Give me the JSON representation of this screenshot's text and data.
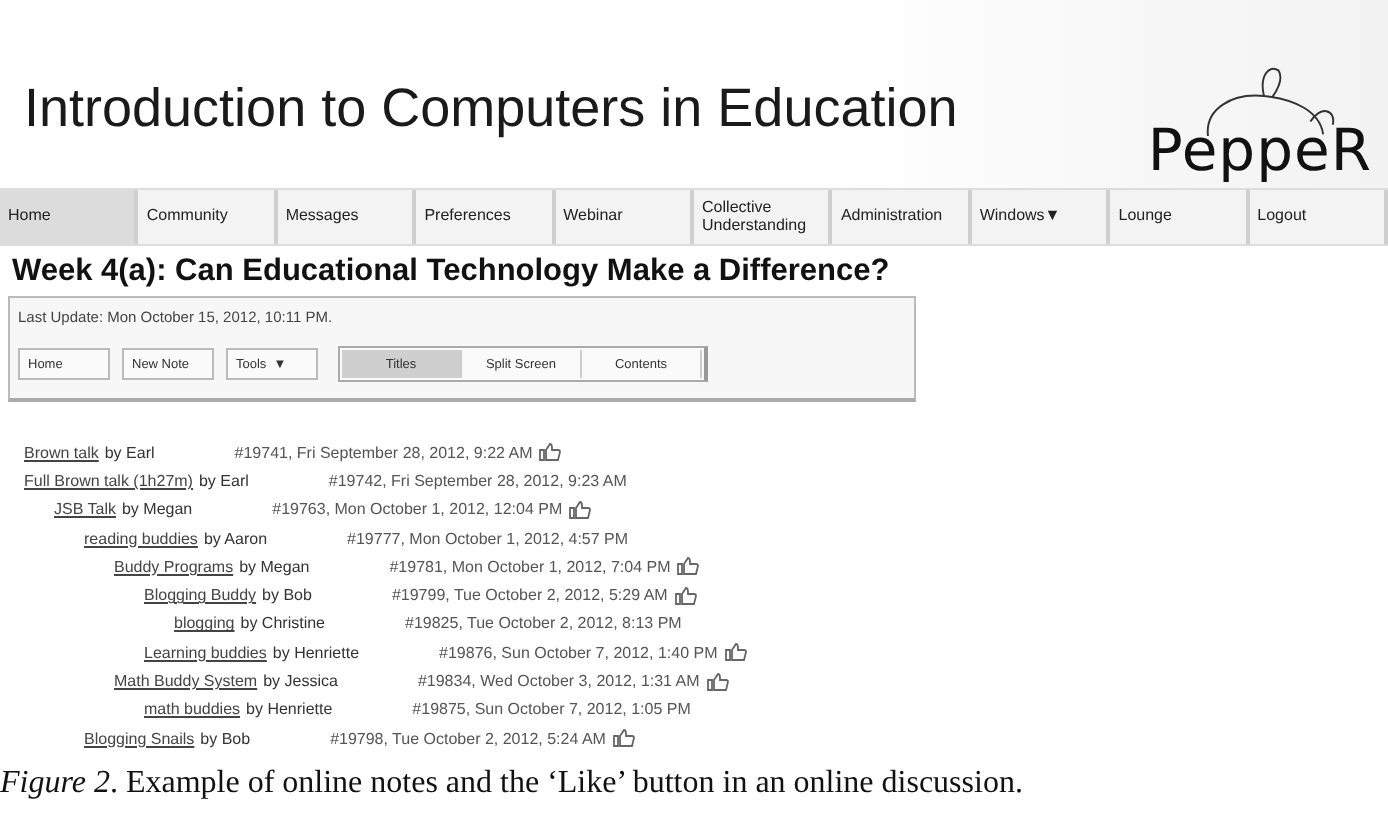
{
  "course_title": "Introduction to Computers in Education",
  "logo": "PeppeR",
  "nav": [
    {
      "label": "Home",
      "selected": true
    },
    {
      "label": "Community",
      "selected": false
    },
    {
      "label": "Messages",
      "selected": false
    },
    {
      "label": "Preferences",
      "selected": false
    },
    {
      "label": "Webinar",
      "selected": false
    },
    {
      "label": "Collective Understanding",
      "selected": false
    },
    {
      "label": "Administration",
      "selected": false
    },
    {
      "label": "Windows",
      "caret": "▼",
      "selected": false
    },
    {
      "label": "Lounge",
      "selected": false
    },
    {
      "label": "Logout",
      "selected": false
    }
  ],
  "view_title": "Week 4(a): Can Educational Technology Make a Difference?",
  "last_update": "Last Update: Mon October 15, 2012, 10:11 PM.",
  "toolbar": [
    {
      "label": "Home"
    },
    {
      "label": "New Note"
    },
    {
      "label": "Tools",
      "caret": "▼"
    }
  ],
  "view_modes": [
    {
      "label": "Titles",
      "selected": true
    },
    {
      "label": "Split Screen",
      "selected": false
    },
    {
      "label": "Contents",
      "selected": false
    }
  ],
  "notes": [
    {
      "title": "Brown talk",
      "by": "by Earl",
      "meta": "#19741, Fri September 28, 2012, 9:22 AM",
      "liked": true
    },
    {
      "title": "Full Brown talk (1h27m)",
      "by": "by Earl",
      "meta": "#19742, Fri September 28, 2012, 9:23 AM",
      "liked": false,
      "children": [
        {
          "title": "JSB Talk",
          "by": "by Megan",
          "meta": "#19763, Mon October 1, 2012, 12:04 PM",
          "liked": true,
          "children": [
            {
              "title": "reading buddies",
              "by": "by Aaron",
              "meta": "#19777, Mon October 1, 2012, 4:57 PM",
              "liked": false,
              "children": [
                {
                  "title": "Buddy Programs",
                  "by": "by Megan",
                  "meta": "#19781, Mon October 1, 2012, 7:04 PM",
                  "liked": true,
                  "children": [
                    {
                      "title": "Blogging Buddy",
                      "by": "by Bob",
                      "meta": "#19799, Tue October 2, 2012, 5:29 AM",
                      "liked": true,
                      "children": [
                        {
                          "title": "blogging",
                          "by": "by Christine",
                          "meta": "#19825, Tue October 2, 2012, 8:13 PM",
                          "liked": false
                        }
                      ]
                    },
                    {
                      "title": "Learning buddies",
                      "by": "by Henriette",
                      "meta": "#19876, Sun October 7, 2012, 1:40 PM",
                      "liked": true
                    }
                  ]
                },
                {
                  "title": "Math Buddy System",
                  "by": "by Jessica",
                  "meta": "#19834, Wed October 3, 2012, 1:31 AM",
                  "liked": true,
                  "children": [
                    {
                      "title": "math buddies",
                      "by": "by Henriette",
                      "meta": "#19875, Sun October 7, 2012, 1:05 PM",
                      "liked": false
                    }
                  ]
                }
              ]
            },
            {
              "title": "Blogging Snails",
              "by": "by Bob",
              "meta": "#19798, Tue October 2, 2012, 5:24 AM",
              "liked": true
            }
          ]
        }
      ]
    }
  ],
  "caption": "*Figure 2*. Example of online notes and the ‘Like’ button in an online discussion."
}
